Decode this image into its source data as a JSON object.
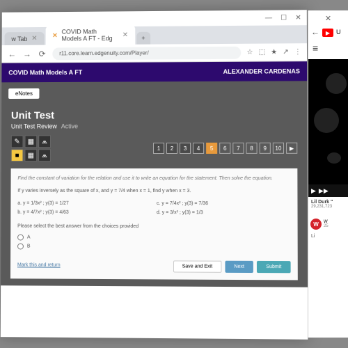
{
  "window": {
    "min": "—",
    "max": "☐",
    "close": "✕"
  },
  "browser": {
    "tabs": [
      {
        "title": "w Tab",
        "active": false
      },
      {
        "title": "COVID Math Models A FT - Edg",
        "active": true
      }
    ],
    "plus": "+",
    "url": "r11.core.learn.edgenuity.com/Player/",
    "icons": [
      "☆",
      "⬚",
      "★",
      "↗",
      "⋮"
    ]
  },
  "app": {
    "header_left": "COVID Math Models A FT",
    "header_right": "ALEXANDER CARDENAS",
    "enotes": "eNotes",
    "title": "Unit Test",
    "subtitle": "Unit Test Review",
    "status": "Active",
    "tools": [
      "✎",
      "▦",
      "⩕",
      "■",
      "▦",
      "⩕"
    ],
    "pages": [
      "1",
      "2",
      "3",
      "4",
      "5",
      "6",
      "7",
      "8",
      "9",
      "10",
      "▶"
    ],
    "current_page": 5
  },
  "question": {
    "intro": "Find the constant of variation for the relation and use it to write an equation for the statement. Then solve the equation.",
    "text": "If y varies inversely as the square of x, and y = 7/4 when x = 1, find y when x = 3.",
    "a": "a.  y = 1/3x² ; y(3) = 1/27",
    "b": "b.  y = 4/7x² ; y(3) = 4/63",
    "c": "c.  y = 7/4x² ; y(3) = 7/36",
    "d": "d.  y = 3/x² ; y(3) = 1/3",
    "select": "Please select the best answer from the choices provided",
    "optA": "A",
    "optB": "B",
    "mark": "Mark this and return",
    "save": "Save and Exit",
    "next": "Next",
    "submit": "Submit"
  },
  "side": {
    "u": "U",
    "ham": "≡",
    "play": "▶",
    "next": "▶▶",
    "vid_title": "Lil Durk \"",
    "views": "29,231,723",
    "ch": "W",
    "ch_name": "W",
    "ch_sub": "25",
    "li": "Li"
  }
}
